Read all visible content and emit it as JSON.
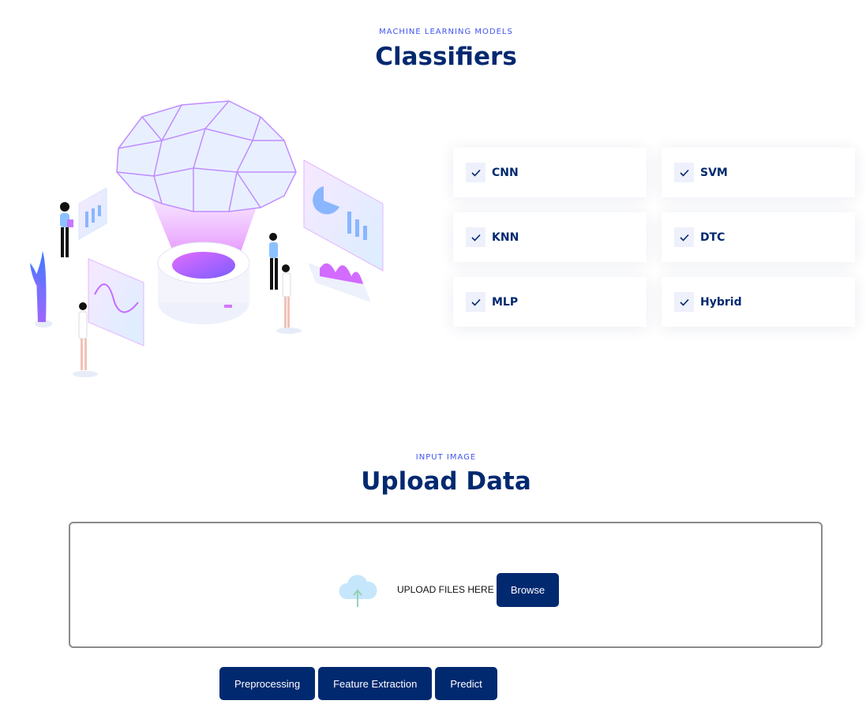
{
  "classifiers_section": {
    "eyebrow": "MACHINE LEARNING MODELS",
    "title": "Classifiers",
    "items": [
      {
        "label": "CNN",
        "checked": true
      },
      {
        "label": "SVM",
        "checked": true
      },
      {
        "label": "KNN",
        "checked": true
      },
      {
        "label": "DTC",
        "checked": true
      },
      {
        "label": "MLP",
        "checked": true
      },
      {
        "label": "Hybrid",
        "checked": true
      }
    ],
    "illustration": "brain-ai-illustration"
  },
  "upload_section": {
    "eyebrow": "INPUT IMAGE",
    "title": "Upload Data",
    "upload_icon": "cloud-upload-icon",
    "prompt": "UPLOAD FILES HERE",
    "browse_label": "Browse"
  },
  "actions": {
    "preprocessing": "Preprocessing",
    "feature_extraction": "Feature Extraction",
    "predict": "Predict"
  },
  "colors": {
    "primary": "#012970",
    "accent": "#4154f1",
    "gradient_pink": "#d96bff",
    "gradient_blue": "#6fa8ff"
  }
}
